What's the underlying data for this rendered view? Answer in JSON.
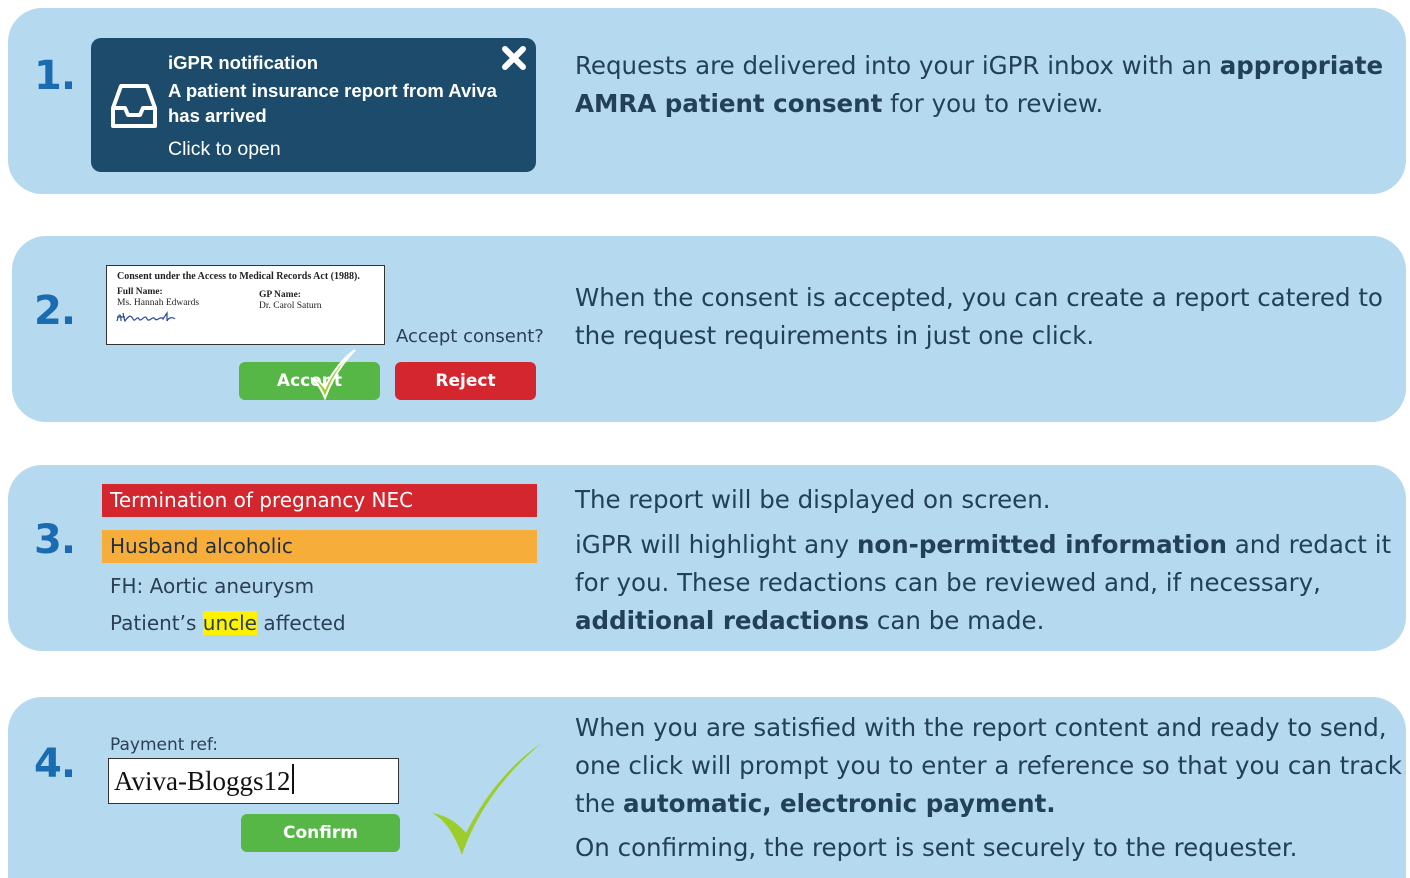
{
  "steps": [
    {
      "number": "1.",
      "notification": {
        "title": "iGPR notification",
        "message": "A patient insurance report from Aviva has arrived",
        "link": "Click to open"
      },
      "description": {
        "pre": "Requests are delivered into your iGPR inbox with an ",
        "bold": "appropriate AMRA patient consent",
        "post": " for you to review."
      }
    },
    {
      "number": "2.",
      "consent": {
        "heading": "Consent under the Access to Medical Records Act (1988).",
        "full_name_label": "Full Name:",
        "full_name_value": "Ms. Hannah Edwards",
        "gp_name_label": "GP Name:",
        "gp_name_value": "Dr. Carol Saturn",
        "signature": "HEdwards"
      },
      "question": "Accept consent?",
      "accept_label": "Accept",
      "reject_label": "Reject",
      "description": "When the consent is accepted, you can create a report catered to the request requirements in just one click."
    },
    {
      "number": "3.",
      "items": [
        "Termination of pregnancy NEC",
        "Husband alcoholic",
        "FH: Aortic aneurysm"
      ],
      "patient_line": {
        "pre": "Patient’s ",
        "highlight": "uncle",
        "post": " affected"
      },
      "description": {
        "line1": "The report will be displayed on screen.",
        "pre": "iGPR will highlight any ",
        "bold1": "non-permitted information",
        "mid": " and redact it for you.  These redactions can be reviewed and, if necessary, ",
        "bold2": "additional redactions",
        "post": " can be made."
      }
    },
    {
      "number": "4.",
      "payment_label": "Payment ref:",
      "payment_value": "Aviva-Bloggs12",
      "confirm_label": "Confirm",
      "description": {
        "pre": "When you are satisfied with the report content and ready to send, one click will prompt you to enter a reference so that you can track the ",
        "bold": "automatic, electronic payment.",
        "line2": "On confirming, the report is sent securely to the requester."
      }
    }
  ],
  "colors": {
    "panel": "#b5d9ef",
    "number": "#1b6bb0",
    "notification": "#1d4b6b",
    "accept": "#56b747",
    "reject": "#d4262e",
    "redaction_red": "#d4262e",
    "redaction_orange": "#f7ad3a",
    "highlight": "#fff200",
    "tick": "#9ccd2a"
  },
  "icons": [
    "inbox-icon",
    "close-icon",
    "checkmark-icon"
  ]
}
